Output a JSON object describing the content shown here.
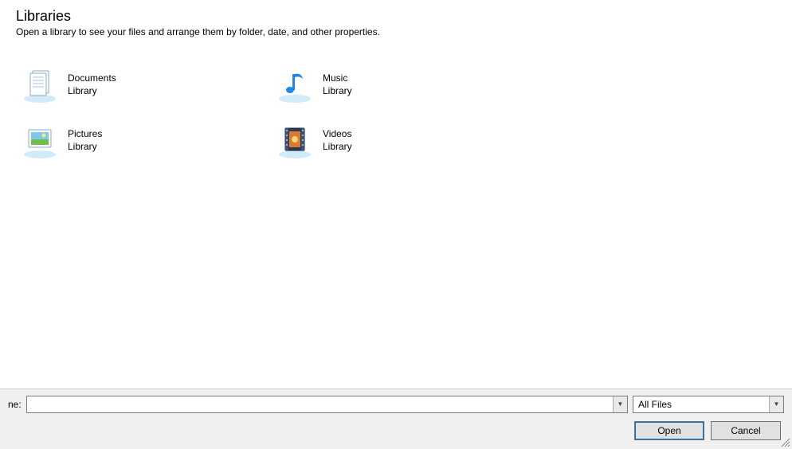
{
  "header": {
    "title": "Libraries",
    "subtitle": "Open a library to see your files and arrange them by folder, date, and other properties."
  },
  "libraries": [
    {
      "name": "Documents",
      "type": "Library",
      "icon": "documents"
    },
    {
      "name": "Music",
      "type": "Library",
      "icon": "music"
    },
    {
      "name": "Pictures",
      "type": "Library",
      "icon": "pictures"
    },
    {
      "name": "Videos",
      "type": "Library",
      "icon": "videos"
    }
  ],
  "footer": {
    "filename_label_suffix": "ne:",
    "filename_value": "",
    "filter_selected": "All Files",
    "open_label": "Open",
    "cancel_label": "Cancel"
  }
}
